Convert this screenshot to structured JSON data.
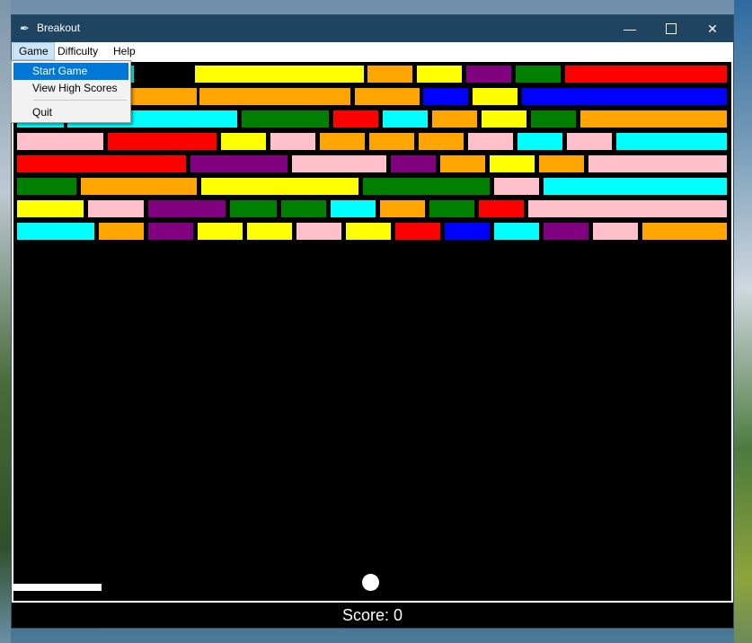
{
  "window": {
    "title": "Breakout",
    "minimize_symbol": "—",
    "close_symbol": "✕"
  },
  "menubar": {
    "items": [
      "Game",
      "Difficulty",
      "Help"
    ]
  },
  "game_menu": {
    "items": [
      "Start Game",
      "View High Scores",
      "Quit"
    ]
  },
  "score": {
    "label": "Score: 0"
  },
  "colors": {
    "cyan": "#00ffff",
    "yellow": "#ffff00",
    "orange": "#ffa500",
    "purple": "#800080",
    "green": "#008000",
    "red": "#ff0000",
    "blue": "#0000ff",
    "pink": "#ffc0cb"
  },
  "bricks": [
    [
      "cyan",
      "cyan",
      "yellow",
      "orange",
      "yellow",
      "purple",
      "green",
      "red"
    ],
    [
      "orange",
      "orange",
      "orange",
      "blue",
      "yellow",
      "blue",
      "blue"
    ],
    [
      "cyan",
      "cyan",
      "green",
      "red",
      "cyan",
      "orange",
      "yellow",
      "green",
      "orange"
    ],
    [
      "pink",
      "red",
      "yellow",
      "pink",
      "orange",
      "orange",
      "orange",
      "pink",
      "cyan",
      "pink",
      "cyan"
    ],
    [
      "red",
      "purple",
      "pink",
      "purple",
      "orange",
      "yellow",
      "orange",
      "pink"
    ],
    [
      "green",
      "orange",
      "yellow",
      "green",
      "pink",
      "cyan"
    ],
    [
      "yellow",
      "pink",
      "purple",
      "green",
      "green",
      "cyan",
      "orange",
      "green",
      "red",
      "pink"
    ],
    [
      "cyan",
      "orange",
      "purple",
      "yellow",
      "yellow",
      "pink",
      "yellow",
      "red",
      "blue",
      "cyan",
      "purple",
      "pink",
      "orange"
    ]
  ]
}
